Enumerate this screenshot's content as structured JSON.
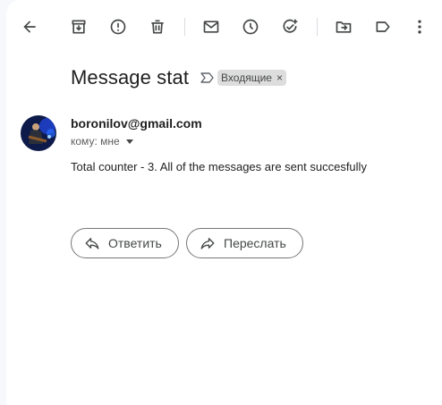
{
  "toolbar": {
    "icons": [
      "back-arrow-icon",
      "archive-icon",
      "report-spam-icon",
      "delete-icon",
      "mark-unread-icon",
      "snooze-icon",
      "add-to-tasks-icon",
      "move-to-icon",
      "labels-icon",
      "more-vert-icon"
    ]
  },
  "message": {
    "subject": "Message stat",
    "label": "Входящие",
    "label_remove": "×",
    "sender": "boronilov@gmail.com",
    "to": "кому: мне",
    "body": "Total counter - 3. All of the messages are sent succesfully"
  },
  "actions": {
    "reply_label": "Ответить",
    "forward_label": "Переслать"
  },
  "colors": {
    "background": "#f6f8fc",
    "panel": "#ffffff",
    "icon": "#444746",
    "chip_bg": "#dddddd"
  }
}
